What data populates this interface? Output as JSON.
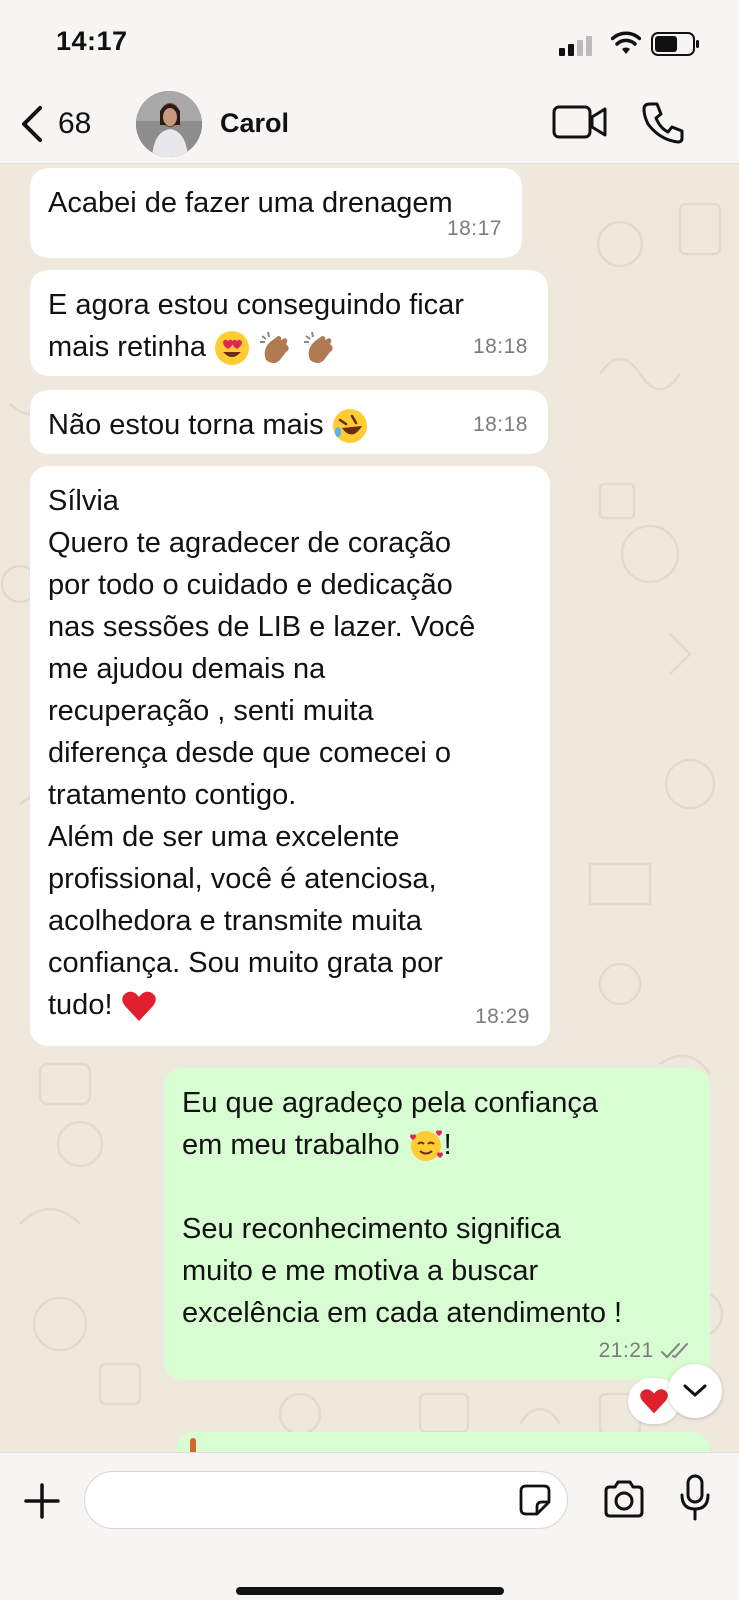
{
  "status_bar": {
    "time": "14:17"
  },
  "header": {
    "back_count": "68",
    "contact_name": "Carol"
  },
  "messages": [
    {
      "direction": "incoming",
      "text": "Acabei de fazer uma drenagem",
      "time": "18:17"
    },
    {
      "direction": "incoming",
      "text": "E agora estou conseguindo ficar\nmais retinha",
      "emojis": [
        "heart-eyes",
        "clapping-hands",
        "clapping-hands"
      ],
      "time": "18:18"
    },
    {
      "direction": "incoming",
      "text": "Não estou torna mais",
      "emojis": [
        "rolling-laughing"
      ],
      "time": "18:18"
    },
    {
      "direction": "incoming",
      "text": "Sílvia\nQuero te agradecer de coração\npor todo o cuidado e dedicação\nnas sessões de LIB e lazer. Você\nme ajudou demais na\nrecuperação , senti muita\ndiferença desde que comecei o\ntratamento contigo.\nAlém de ser uma excelente\nprofissional, você é atenciosa,\nacolhedora e transmite muita\nconfiança. Sou muito grata por\ntudo!",
      "emojis": [
        "red-heart"
      ],
      "time": "18:29"
    },
    {
      "direction": "outgoing",
      "text_before_emoji": "Eu que agradeço pela confiança\nem meu trabalho ",
      "text_after_emoji": "!\n\nSeu reconhecimento significa\nmuito e me motiva a buscar\nexcelência em cada atendimento !",
      "emojis": [
        "smiling-hearts"
      ],
      "time": "21:21",
      "read": true,
      "reaction": "red-heart"
    }
  ],
  "input": {
    "placeholder": ""
  },
  "colors": {
    "incoming_bubble": "#ffffff",
    "outgoing_bubble": "#d9fdd3",
    "wallpaper": "#efe8dc",
    "read_ticks": "#8a8a8a"
  }
}
